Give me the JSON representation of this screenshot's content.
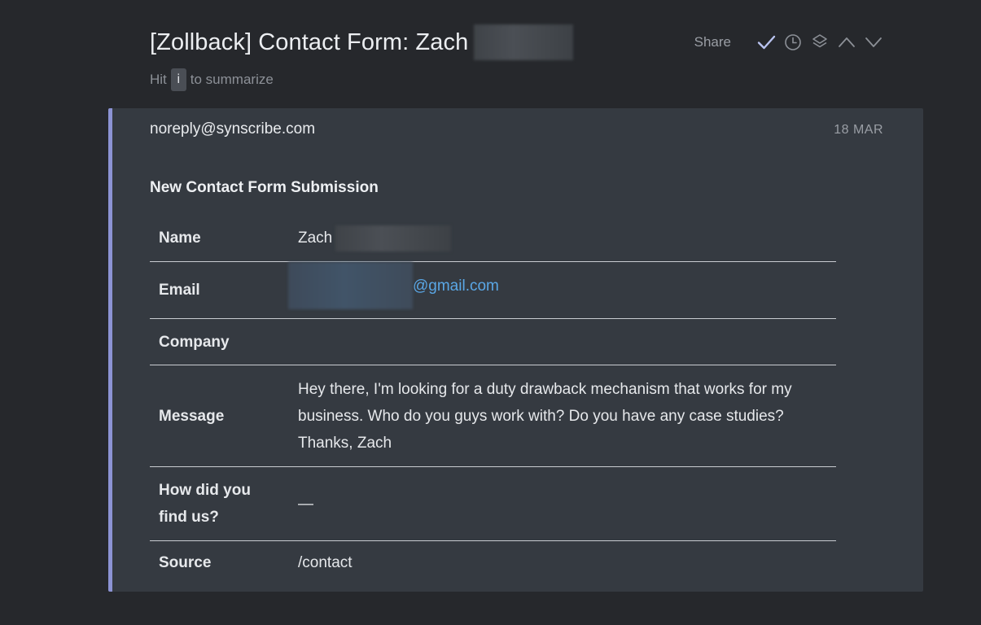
{
  "thread": {
    "subject": "[Zollback] Contact Form: Zach",
    "hint_prefix": "Hit",
    "hint_key": "i",
    "hint_suffix": "to summarize"
  },
  "toolbar": {
    "share_label": "Share",
    "icons": [
      "check-icon",
      "clock-icon",
      "layers-icon",
      "chevron-up-icon",
      "chevron-down-icon"
    ]
  },
  "message": {
    "sender": "noreply@synscribe.com",
    "date": "18 MAR",
    "heading": "New Contact Form Submission",
    "accent_color": "#8c93d4",
    "fields": {
      "name": {
        "label": "Name",
        "value": "Zach"
      },
      "email": {
        "label": "Email",
        "value": "@gmail.com",
        "link_color": "#5aa7e6"
      },
      "company": {
        "label": "Company",
        "value": ""
      },
      "message": {
        "label": "Message",
        "value": "Hey there, I'm looking for a duty drawback mechanism that works for my business. Who do you guys work with? Do you have any case studies? Thanks, Zach"
      },
      "how_found": {
        "label": "How did you find us?",
        "value": "—"
      },
      "source": {
        "label": "Source",
        "value": "/contact"
      }
    }
  }
}
